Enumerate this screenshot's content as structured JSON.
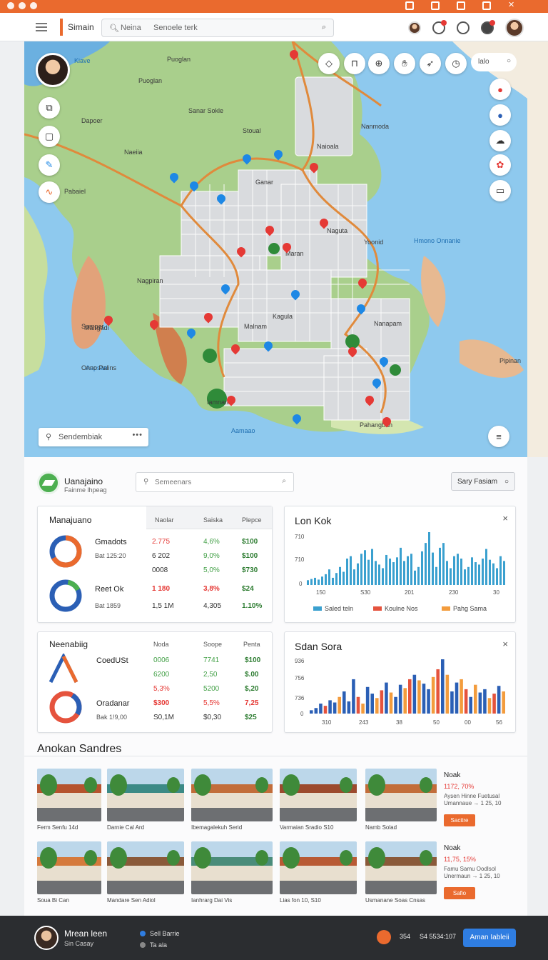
{
  "header": {
    "brand": "Simain",
    "search_left": "Neina",
    "search_placeholder": "Senoele terk"
  },
  "map": {
    "labels": [
      "Kiave",
      "Puoglan",
      "Puoglan",
      "Sanar Sokle",
      "Dapoer",
      "Stoual",
      "Nanmoda",
      "Naioala",
      "Naeiia",
      "Pabaiel",
      "Ganar",
      "Naguta",
      "Maran",
      "Nagpiran",
      "Yoonid",
      "Kagula",
      "Malnam",
      "Sampar",
      "Aapsan",
      "Mangadi",
      "Onno Palins",
      "Nanapam",
      "Iamnaris",
      "Pahangban",
      "Pipinan",
      "Hmono Onnanie",
      "Aamaao"
    ],
    "search_placeholder": "Sendembiak",
    "top_search": "lalo",
    "menu_dots": "•••"
  },
  "panel": {
    "site_title": "Uanajaino",
    "site_subtitle": "Fainme lhpeag",
    "search_placeholder": "Semeenars",
    "button_label": "Sary Fasiam"
  },
  "card1": {
    "title": "Manajuano",
    "columns": [
      "Naolar",
      "Saiska",
      "Plepce"
    ],
    "rows": [
      {
        "label": "Gmadots",
        "sub": "Bat 125:20",
        "v1": "2.775",
        "v2": "4,6%",
        "v3": "$100"
      },
      {
        "label": "",
        "sub": "",
        "v1": "6 202",
        "v2": "9,0%",
        "v3": "$100"
      },
      {
        "label": "",
        "sub": "",
        "v1": "0008",
        "v2": "5,0%",
        "v3": "$730"
      },
      {
        "label": "Reet Ok",
        "sub": "",
        "v1": "1 180",
        "v2": "3,8%",
        "v3": "$24"
      },
      {
        "label": "",
        "sub": "Bat 1859",
        "v1": "1,5 1M",
        "v2": "4,305",
        "v3": "1.10%"
      }
    ]
  },
  "card2": {
    "title": "Lon Kok",
    "close": "×",
    "chart_data": {
      "type": "bar",
      "y_ticks": [
        "710",
        "710",
        "0"
      ],
      "x_ticks": [
        "150",
        "S30",
        "201",
        "230",
        "30"
      ],
      "legend": [
        "Saled teln",
        "Koulne Nos",
        "Pahg Sama"
      ],
      "colors": [
        "#3aa0cf",
        "#e5533d",
        "#f39c3d"
      ],
      "values": [
        8,
        10,
        12,
        9,
        14,
        18,
        26,
        12,
        20,
        30,
        22,
        44,
        48,
        26,
        36,
        52,
        58,
        42,
        60,
        40,
        34,
        28,
        50,
        44,
        38,
        46,
        62,
        40,
        48,
        52,
        24,
        30,
        56,
        70,
        88,
        54,
        30,
        62,
        70,
        40,
        28,
        48,
        52,
        44,
        26,
        30,
        46,
        38,
        34,
        44,
        60,
        42,
        36,
        28,
        48,
        40
      ]
    }
  },
  "card3": {
    "title": "Neenabiig",
    "columns": [
      "Noda",
      "Soope",
      "Penta"
    ],
    "rows": [
      {
        "label": "CoedUSt",
        "sub": "",
        "v1": "0006",
        "v2": "7741",
        "v3": "$100"
      },
      {
        "label": "",
        "sub": "",
        "v1": "6200",
        "v2": "2,50",
        "v3": "$.00"
      },
      {
        "label": "",
        "sub": "",
        "v1": "5,3%",
        "v2": "5200",
        "v3": "$,20"
      },
      {
        "label": "Oradanar",
        "sub": "",
        "v1": "$300",
        "v2": "5,5%",
        "v3": "7,25"
      },
      {
        "label": "",
        "sub": "Bak 1!9,00",
        "v1": "S0,1M",
        "v2": "$0,30",
        "v3": "$25"
      }
    ]
  },
  "card4": {
    "title": "Sdan Sora",
    "close": "×",
    "chart_data": {
      "type": "bar",
      "y_ticks": [
        "936",
        "756",
        "736",
        "0"
      ],
      "x_ticks": [
        "310",
        "243",
        "38",
        "50",
        "00",
        "56"
      ],
      "series": [
        {
          "color": "#2b5fb5",
          "values": [
            6,
            10,
            18,
            14,
            24,
            20,
            30,
            40,
            22,
            62,
            30,
            18
          ]
        },
        {
          "color": "#e5533d",
          "values": [
            0,
            0,
            0,
            0,
            0,
            0,
            0,
            0,
            0,
            0,
            0,
            0
          ]
        }
      ],
      "values": [
        6,
        10,
        18,
        14,
        24,
        20,
        30,
        40,
        22,
        62,
        30,
        18,
        48,
        36,
        28,
        42,
        56,
        38,
        30,
        52,
        46,
        62,
        70,
        60,
        54,
        44,
        66,
        80,
        98,
        70,
        40,
        56,
        62,
        44,
        30,
        52,
        38,
        44,
        28,
        36,
        50,
        40
      ],
      "colors_seq": [
        "#2b5fb5",
        "#2b5fb5",
        "#2b5fb5",
        "#e5533d",
        "#2b5fb5",
        "#2b5fb5",
        "#f39c3d",
        "#2b5fb5",
        "#2b5fb5",
        "#2b5fb5",
        "#e5533d",
        "#f39c3d"
      ]
    }
  },
  "section": {
    "title": "Anokan Sandres",
    "gallery_row1": [
      "Ferm Senfu 14d",
      "Darnie Cal Ard",
      "Ibemagalekuh Serid",
      "Varmaian Sradio S10"
    ],
    "gallery_row2": [
      "Soua Bi Can",
      "Mandare Sen Adiol",
      "Ianhrarg Dai Vis",
      "Lias fon 10, S10"
    ],
    "caption_small1": "Namb Solad",
    "caption_small2": "Usmanane Soas Cnsas",
    "side1": {
      "title": "Noak",
      "price": "1172, 70%",
      "desc1": "Aysen Hinne Fuetusal",
      "desc2": "Umannaue → 1 25, 10",
      "button": "Sacitre"
    },
    "side2": {
      "title": "Noak",
      "price": "11,75, 15%",
      "desc1": "Famu Samu Oodlsol",
      "desc2": "Unermaun → 1 25, 10",
      "button": "Safio"
    }
  },
  "footer": {
    "name": "Mrean leen",
    "sub": "Sin Casay",
    "item1": "Sell Barrie",
    "item2": "Ta ala",
    "stat1": "354",
    "stat2": "S4 5534:107",
    "button": "Aman Iableii"
  }
}
